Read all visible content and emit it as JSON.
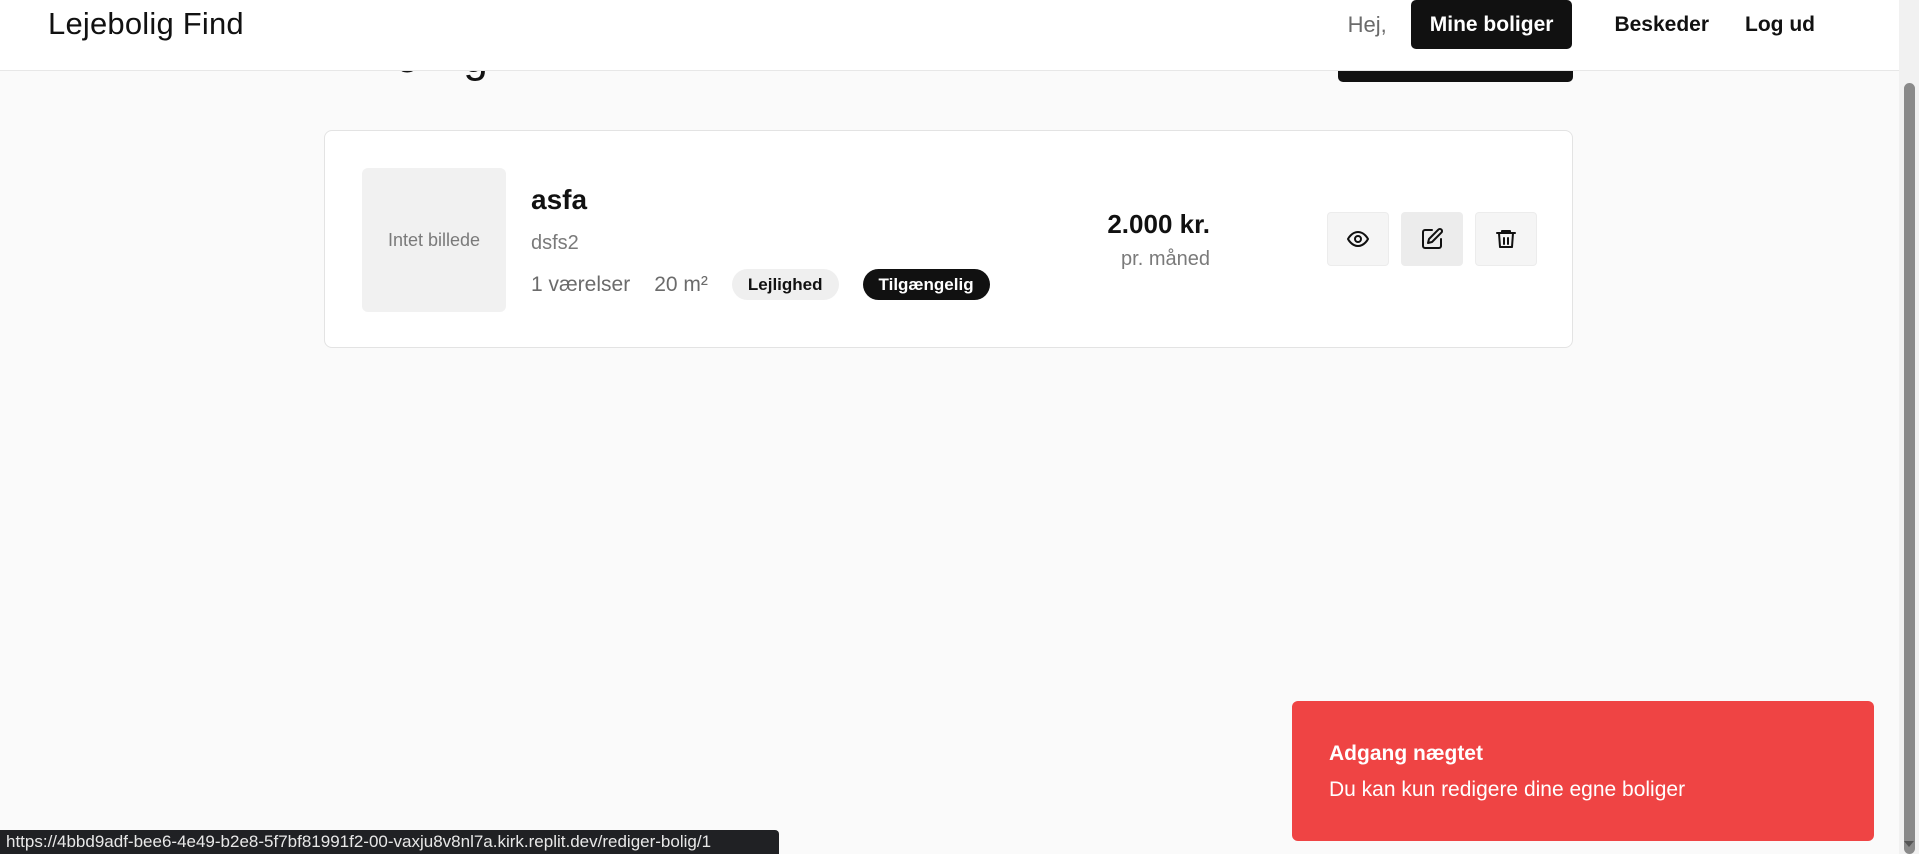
{
  "header": {
    "brand": "Lejebolig Find",
    "greeting": "Hej,",
    "nav": {
      "my_listings": "Mine boliger",
      "messages": "Beskeder",
      "logout": "Log ud"
    }
  },
  "page": {
    "title_partial": "···o···g·"
  },
  "listing": {
    "image_placeholder": "Intet billede",
    "title": "asfa",
    "subtitle": "dsfs2",
    "rooms": "1 værelser",
    "area": "20 m²",
    "type_badge": "Lejlighed",
    "status_badge": "Tilgængelig",
    "price": "2.000 kr.",
    "price_period": "pr. måned",
    "actions": [
      "eye-icon",
      "edit-icon",
      "trash-icon"
    ]
  },
  "toast": {
    "title": "Adgang nægtet",
    "message": "Du kan kun redigere dine egne boliger",
    "color": "#ef4444"
  },
  "statusbar": {
    "url": "https://4bbd9adf-bee6-4e49-b2e8-5f7bf81991f2-00-vaxju8v8nl7a.kirk.replit.dev/rediger-bolig/1"
  }
}
